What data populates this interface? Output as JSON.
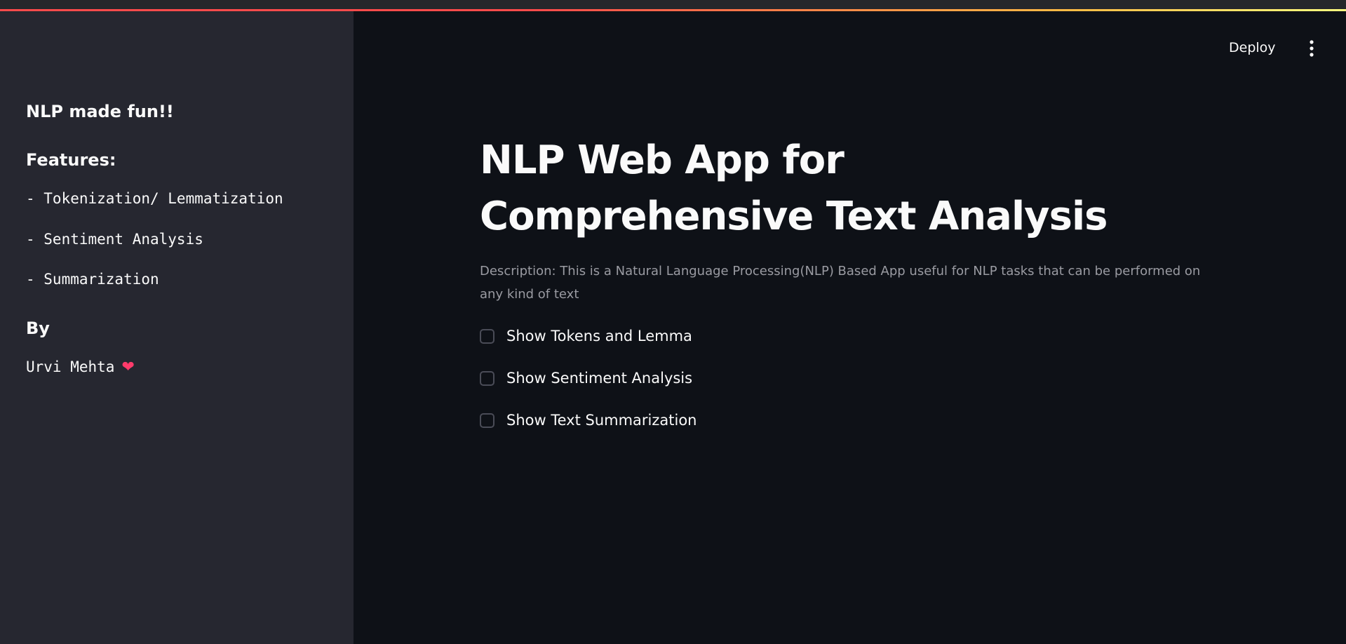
{
  "colors": {
    "sidebar_bg": "#262730",
    "main_bg": "#0e1117",
    "text": "#fafafa",
    "muted_text": "#9a9ba2",
    "accent_red": "#ff4b4b",
    "accent_yellow": "#fffd80",
    "heart": "#ff3b6b"
  },
  "sidebar": {
    "heading": "NLP made fun!!",
    "features_heading": "Features:",
    "features": [
      "- Tokenization/ Lemmatization",
      "- Sentiment Analysis",
      "- Summarization"
    ],
    "by_heading": "By",
    "author": "Urvi Mehta",
    "author_icon": "heart-icon",
    "author_icon_glyph": "❤"
  },
  "header": {
    "deploy_label": "Deploy",
    "menu_icon": "vertical-dots-icon"
  },
  "main": {
    "title": "NLP Web App for Comprehensive Text Analysis",
    "description": "Description: This is a Natural Language Processing(NLP) Based App useful for NLP tasks that can be performed on any kind of text",
    "options": [
      {
        "label": "Show Tokens and Lemma",
        "checked": false
      },
      {
        "label": "Show Sentiment Analysis",
        "checked": false
      },
      {
        "label": "Show Text Summarization",
        "checked": false
      }
    ]
  }
}
